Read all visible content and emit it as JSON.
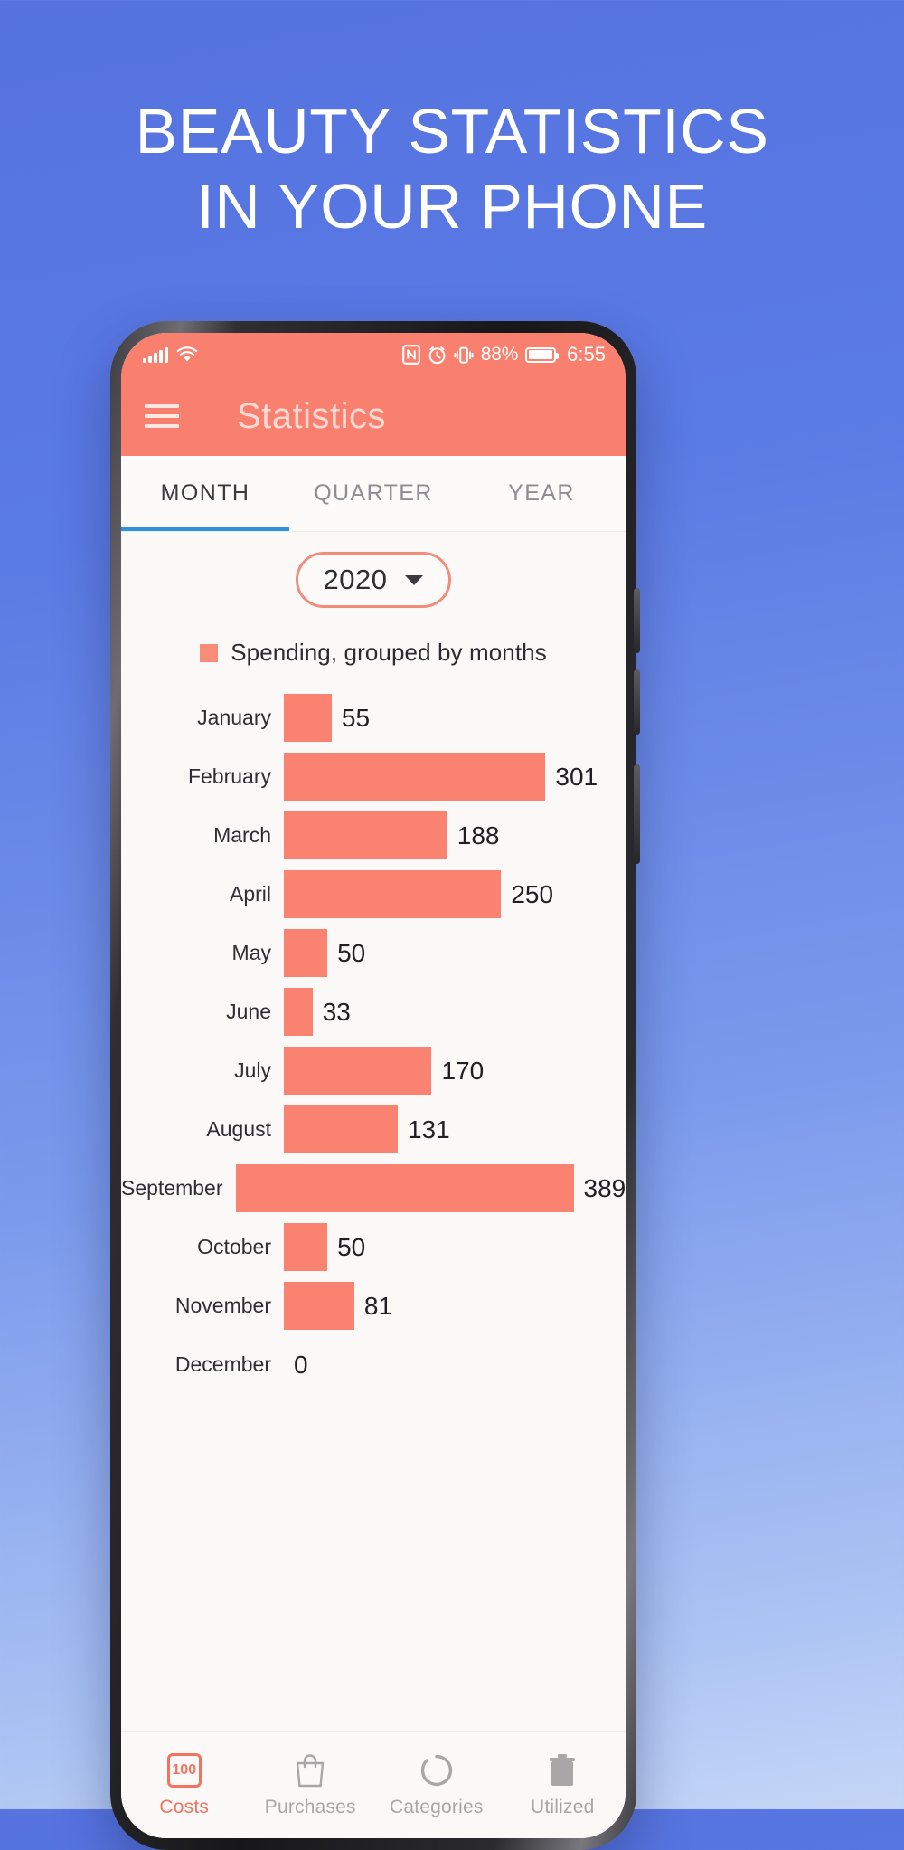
{
  "poster": {
    "headline_line1": "BEAUTY STATISTICS",
    "headline_line2": "IN YOUR PHONE",
    "background_start": "#5673e0",
    "background_end": "#c5d6f7"
  },
  "statusbar": {
    "signal_icon": "cellular-signal-icon",
    "wifi_icon": "wifi-icon",
    "nfc_icon": "nfc-icon",
    "alarm_icon": "alarm-clock-icon",
    "vibrate_icon": "vibrate-icon",
    "battery_percent": "88%",
    "battery_icon": "battery-icon",
    "clock": "6:55"
  },
  "appbar": {
    "menu_icon": "hamburger-menu-icon",
    "title": "Statistics",
    "background": "#f9806f"
  },
  "tabs": [
    {
      "label": "MONTH",
      "active": true
    },
    {
      "label": "QUARTER",
      "active": false
    },
    {
      "label": "YEAR",
      "active": false
    }
  ],
  "tab_indicator_color": "#2f93d8",
  "year_select": {
    "value": "2020",
    "caret_icon": "chevron-down-icon"
  },
  "chart_data": {
    "type": "bar",
    "orientation": "horizontal",
    "title": "",
    "legend": [
      {
        "name": "Spending, grouped by months",
        "color": "#f98b79"
      }
    ],
    "legend_position": "top-center",
    "xlabel": "",
    "ylabel": "",
    "grid": false,
    "xlim": [
      0,
      389
    ],
    "categories": [
      "January",
      "February",
      "March",
      "April",
      "May",
      "June",
      "July",
      "August",
      "September",
      "October",
      "November",
      "December"
    ],
    "values": [
      55,
      301,
      188,
      250,
      50,
      33,
      170,
      131,
      389,
      50,
      81,
      0
    ],
    "bar_color": "#f98271"
  },
  "bottomnav": [
    {
      "label": "Costs",
      "icon": "costs-badge-icon",
      "badge": "100",
      "active": true
    },
    {
      "label": "Purchases",
      "icon": "shopping-bag-icon",
      "active": false
    },
    {
      "label": "Categories",
      "icon": "circle-outline-icon",
      "active": false
    },
    {
      "label": "Utilized",
      "icon": "trash-icon",
      "active": false
    }
  ],
  "accent_color": "#f4735e"
}
